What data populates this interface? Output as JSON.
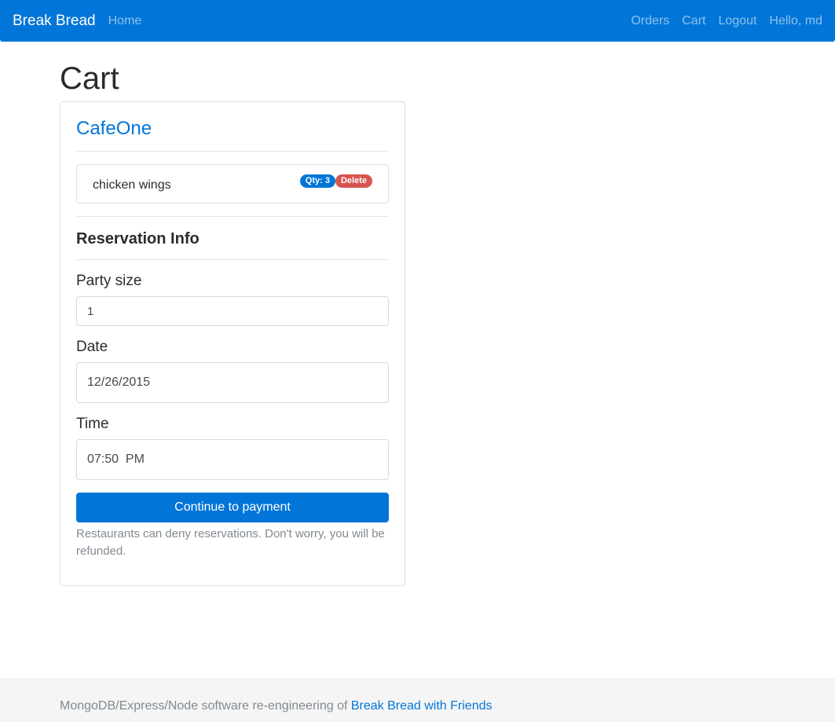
{
  "navbar": {
    "brand": "Break Bread",
    "home": "Home",
    "orders": "Orders",
    "cart": "Cart",
    "logout": "Logout",
    "greeting": "Hello, md"
  },
  "page": {
    "title": "Cart"
  },
  "cart": {
    "restaurant": "CafeOne",
    "items": [
      {
        "name": "chicken wings",
        "qty_badge": "Qty: 3",
        "delete_label": "Delete"
      }
    ]
  },
  "reservation": {
    "heading": "Reservation Info",
    "party_size_label": "Party size",
    "party_size_value": "1",
    "date_label": "Date",
    "date_value": "12/26/2015",
    "time_label": "Time",
    "time_value": "07:50  PM",
    "submit_label": "Continue to payment",
    "note": "Restaurants can deny reservations. Don't worry, you will be refunded."
  },
  "footer": {
    "text": "MongoDB/Express/Node software re-engineering of ",
    "link": "Break Bread with Friends"
  },
  "colors": {
    "primary": "#0275d8",
    "danger": "#d9534f",
    "muted": "#818a91"
  }
}
